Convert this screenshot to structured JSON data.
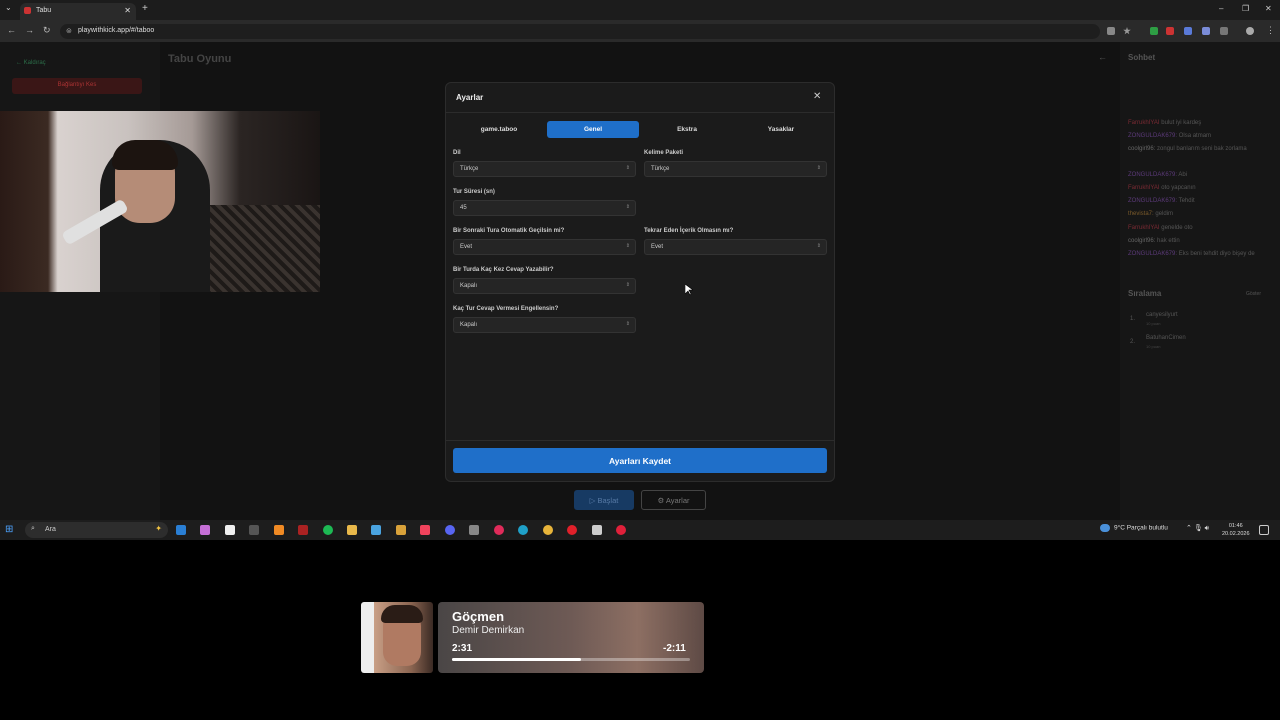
{
  "browser": {
    "tab_title": "Tabu",
    "url": "playwithkick.app/#/taboo"
  },
  "page": {
    "back_link": "← Kaldıraç",
    "disconnect_button": "Bağlantıyı Kes",
    "game_title": "Tabu Oyunu",
    "start_button": "▷ Başlat",
    "settings_button": "⚙ Ayarlar"
  },
  "chat": {
    "title": "Sohbet",
    "messages": [
      {
        "user": "FarrukhIYAI",
        "text": "bulut iyi kardeş",
        "color": "#7a2a33"
      },
      {
        "user": "ZONGULDAK679:",
        "text": "Olsa atmam",
        "color": "#5c3a7a"
      },
      {
        "user": "coolgirl96:",
        "text": "zongul banlarım seni bak zorlama",
        "color": "#666"
      },
      {
        "user": "ZONGULDAK679:",
        "text": "Abi",
        "color": "#5c3a7a"
      },
      {
        "user": "FarrukhIYAI",
        "text": "oto yapcanın",
        "color": "#7a2a33"
      },
      {
        "user": "ZONGULDAK679:",
        "text": "Tehdit",
        "color": "#5c3a7a"
      },
      {
        "user": "thevista7:",
        "text": "geldim",
        "color": "#7a5a2a"
      },
      {
        "user": "FarrukhIYAI",
        "text": "genelde oto",
        "color": "#7a2a33"
      },
      {
        "user": "coolgirl96:",
        "text": "hak ettin",
        "color": "#666"
      },
      {
        "user": "ZONGULDAK679:",
        "text": "Eks beni tehdit diyo bişey de",
        "color": "#5c3a7a"
      }
    ],
    "ranking_title": "Sıralama",
    "ranking_button": "Göster",
    "ranking": [
      {
        "n": "1.",
        "name": "canyesilyurt",
        "points": "10 puan"
      },
      {
        "n": "2.",
        "name": "BatuhanCimen",
        "points": "10 puan"
      }
    ]
  },
  "modal": {
    "title": "Ayarlar",
    "tabs": [
      "game.taboo",
      "Genel",
      "Ekstra",
      "Yasaklar"
    ],
    "active_tab": "Genel",
    "fields": {
      "language": {
        "label": "Dil",
        "value": "Türkçe"
      },
      "word_pack": {
        "label": "Kelime Paketi",
        "value": "Türkçe"
      },
      "round_time": {
        "label": "Tur Süresi (sn)",
        "value": "45"
      },
      "auto_next": {
        "label": "Bir Sonraki Tura Otomatik Geçilsin mi?",
        "value": "Evet"
      },
      "no_repeat": {
        "label": "Tekrar Eden İçerik Olmasın mı?",
        "value": "Evet"
      },
      "answers_per_round": {
        "label": "Bir Turda Kaç Kez Cevap Yazabilir?",
        "value": "Kapalı"
      },
      "block_rounds": {
        "label": "Kaç Tur Cevap Vermesi Engellensin?",
        "value": "Kapalı"
      }
    },
    "save_button": "Ayarları Kaydet"
  },
  "taskbar": {
    "search_placeholder": "Ara",
    "weather": "9°C  Parçalı bulutlu",
    "time": "01:46",
    "date": "20.02.2026"
  },
  "now_playing": {
    "title": "Göçmen",
    "artist": "Demir Demirkan",
    "elapsed": "2:31",
    "remaining": "-2:11",
    "progress": 0.54
  },
  "colors": {
    "accent": "#1f6fc9"
  }
}
